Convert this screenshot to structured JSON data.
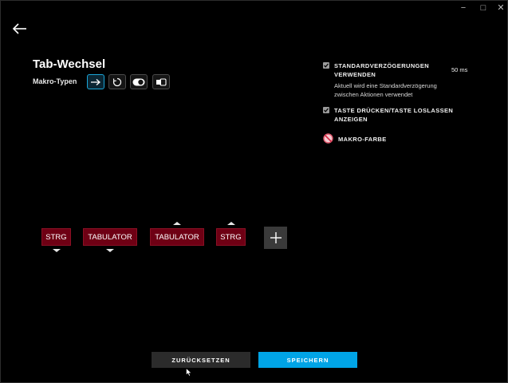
{
  "window": {
    "controls": {
      "minimize": "−",
      "maximize": "□",
      "close": "✕"
    }
  },
  "nav": {
    "back_icon": "arrow-left-icon"
  },
  "macro": {
    "title": "Tab-Wechsel",
    "types_label": "Makro-Typen",
    "types": [
      {
        "icon": "arrow-right-icon",
        "active": true
      },
      {
        "icon": "repeat-icon",
        "active": false
      },
      {
        "icon": "toggle-icon",
        "active": false
      },
      {
        "icon": "sequence-icon",
        "active": false
      }
    ]
  },
  "options": {
    "standard_delay": {
      "checked": true,
      "label_line1": "STANDARDVERZÖGERUNGEN",
      "label_line2": "VERWENDEN",
      "value": "50 ms",
      "description_line1": "Aktuell wird eine Standardverzögerung",
      "description_line2": "zwischen Aktionen verwendet"
    },
    "show_press_release": {
      "checked": true,
      "label_line1": "TASTE DRÜCKEN/TASTE LOSLASSEN",
      "label_line2": "ANZEIGEN"
    },
    "macro_color": {
      "label": "MAKRO-FARBE",
      "icon": "no-color-icon"
    }
  },
  "sequence": [
    {
      "label": "STRG",
      "action": "down"
    },
    {
      "label": "TABULATOR",
      "action": "down"
    },
    {
      "label": "TABULATOR",
      "action": "up"
    },
    {
      "label": "STRG",
      "action": "up"
    }
  ],
  "add_icon": "plus-icon",
  "buttons": {
    "reset": "ZURÜCKSETZEN",
    "save": "SPEICHERN"
  },
  "colors": {
    "accent": "#00a4e6",
    "key_fill": "#6e0014",
    "background": "#000000"
  }
}
